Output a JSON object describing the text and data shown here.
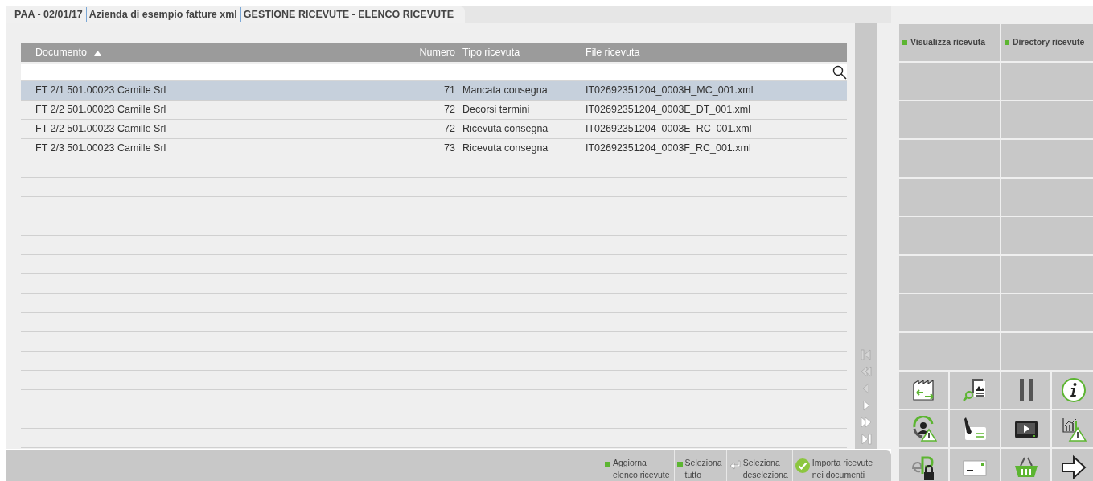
{
  "title_bar": {
    "segments": [
      "PAA - 02/01/17",
      "Azienda di esempio fatture xml",
      "GESTIONE RICEVUTE - ELENCO RICEVUTE"
    ]
  },
  "table": {
    "columns": [
      {
        "label": "Documento",
        "sorted": true
      },
      {
        "label": "Numero",
        "sorted": false
      },
      {
        "label": "Tipo ricevuta",
        "sorted": false
      },
      {
        "label": "File ricevuta",
        "sorted": false
      }
    ],
    "rows": [
      {
        "selected": true,
        "cells": [
          "FT 2/1 501.00023 Camille Srl",
          "71",
          "Mancata consegna",
          "IT02692351204_0003H_MC_001.xml"
        ]
      },
      {
        "selected": false,
        "cells": [
          "FT 2/2 501.00023 Camille Srl",
          "72",
          "Decorsi termini",
          "IT02692351204_0003E_DT_001.xml"
        ]
      },
      {
        "selected": false,
        "cells": [
          "FT 2/2 501.00023 Camille Srl",
          "72",
          "Ricevuta consegna",
          "IT02692351204_0003E_RC_001.xml"
        ]
      },
      {
        "selected": false,
        "cells": [
          "FT 2/3 501.00023 Camille Srl",
          "73",
          "Ricevuta consegna",
          "IT02692351204_0003F_RC_001.xml"
        ]
      }
    ]
  },
  "pager": [
    {
      "kind": "first",
      "disabled": true
    },
    {
      "kind": "prev_page",
      "disabled": true
    },
    {
      "kind": "prev",
      "disabled": true
    },
    {
      "kind": "next",
      "disabled": false
    },
    {
      "kind": "next_page",
      "disabled": false
    },
    {
      "kind": "last",
      "disabled": false
    }
  ],
  "side_buttons": [
    "Visualizza ricevuta",
    "Directory ricevute"
  ],
  "bottom_buttons": [
    {
      "kind": "square",
      "lines": [
        "Aggiorna",
        "elenco ricevute"
      ]
    },
    {
      "kind": "square",
      "lines": [
        "Seleziona",
        "tutto"
      ]
    },
    {
      "kind": "enter",
      "lines": [
        "Seleziona",
        "deseleziona"
      ]
    },
    {
      "kind": "check",
      "lines": [
        "Importa ricevute",
        "nei documenti"
      ]
    }
  ]
}
